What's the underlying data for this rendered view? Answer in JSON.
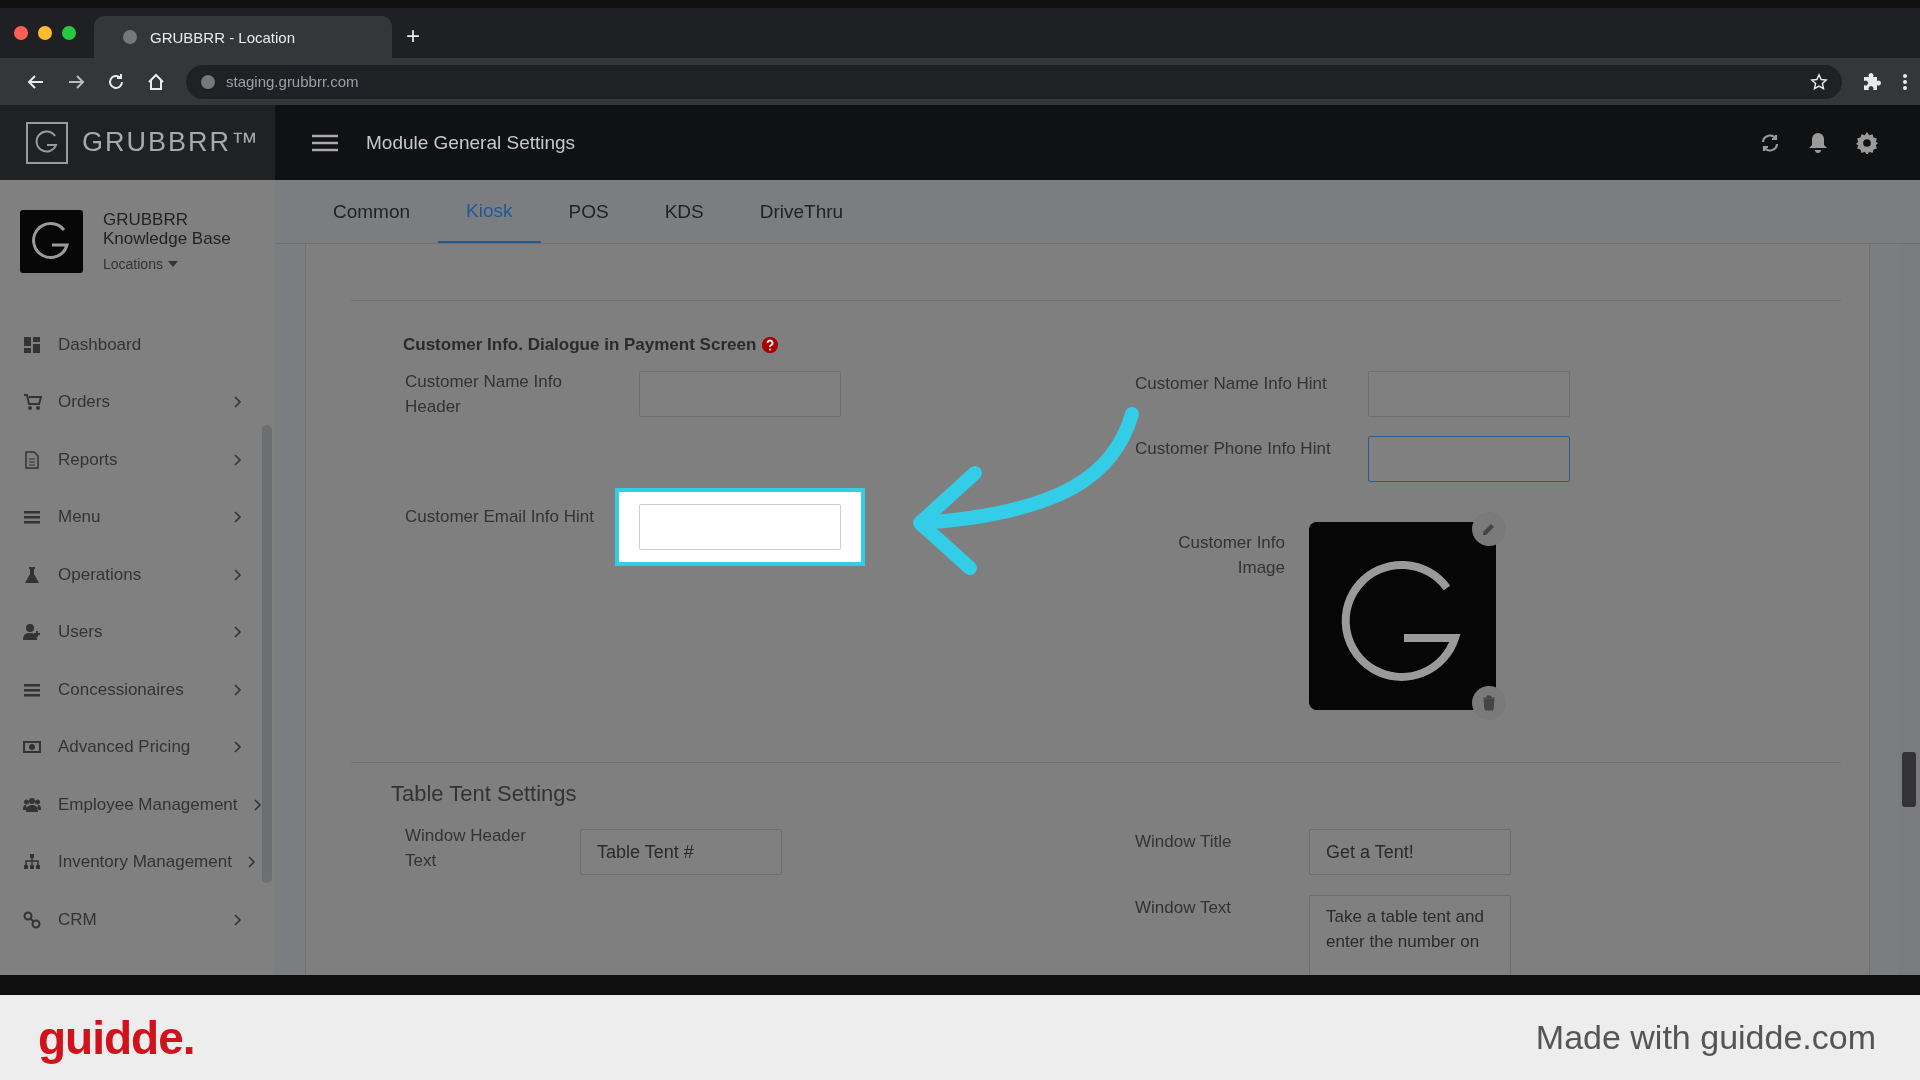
{
  "browser": {
    "tab_title": "GRUBBRR - Location",
    "new_tab": "+",
    "url": "staging.grubbrr.com"
  },
  "header": {
    "logo": "GRUBBRR™",
    "title": "Module General Settings"
  },
  "sidebar": {
    "org_name": "GRUBBRR Knowledge Base",
    "locations": "Locations",
    "items": [
      {
        "label": "Dashboard",
        "expandable": false
      },
      {
        "label": "Orders",
        "expandable": true
      },
      {
        "label": "Reports",
        "expandable": true
      },
      {
        "label": "Menu",
        "expandable": true
      },
      {
        "label": "Operations",
        "expandable": true
      },
      {
        "label": "Users",
        "expandable": true
      },
      {
        "label": "Concessionaires",
        "expandable": true
      },
      {
        "label": "Advanced Pricing",
        "expandable": true
      },
      {
        "label": "Employee Management",
        "expandable": true
      },
      {
        "label": "Inventory Management",
        "expandable": true
      },
      {
        "label": "CRM",
        "expandable": true
      }
    ]
  },
  "tabs": [
    {
      "label": "Common",
      "selected": false
    },
    {
      "label": "Kiosk",
      "selected": true
    },
    {
      "label": "POS",
      "selected": false
    },
    {
      "label": "KDS",
      "selected": false
    },
    {
      "label": "DriveThru",
      "selected": false
    }
  ],
  "customer_info": {
    "title": "Customer Info. Dialogue in Payment Screen",
    "name_header": {
      "label": "Customer Name Info Header",
      "highlighted": false
    },
    "email_hint": {
      "label": "Customer Email Info Hint",
      "highlighted": true
    },
    "name_hint": {
      "label": "Customer Name Info Hint",
      "highlighted": false
    },
    "phone_hint": {
      "label": "Customer Phone Info Hint",
      "highlighted": false
    },
    "image": {
      "label": "Customer Info Image"
    }
  },
  "table_tent": {
    "title": "Table Tent Settings",
    "window_header_text": {
      "label": "Window Header Text",
      "value": "Table Tent #"
    },
    "window_title": {
      "label": "Window Title",
      "value": "Get a Tent!"
    },
    "window_text": {
      "label": "Window Text",
      "value": "Take a table tent and enter the number on"
    }
  },
  "footer": {
    "brand": "guidde.",
    "credit": "Made with guidde.com"
  }
}
